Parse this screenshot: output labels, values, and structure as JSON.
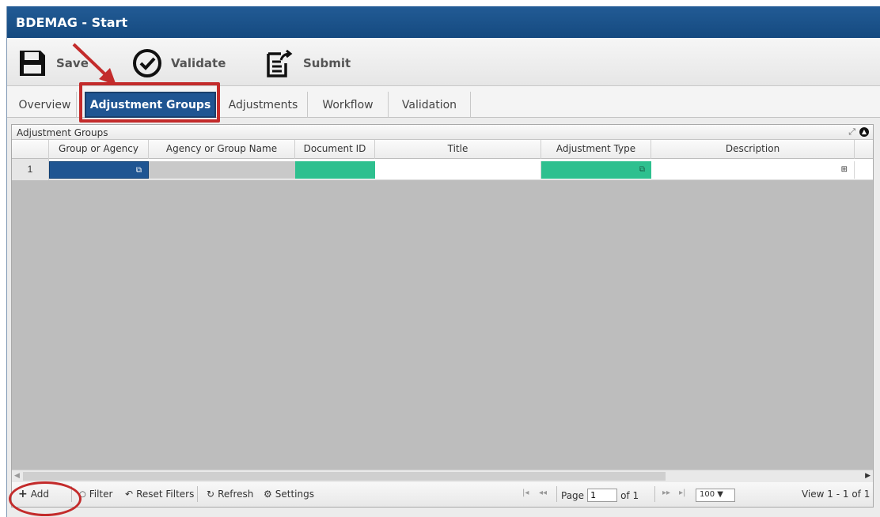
{
  "window": {
    "title": "BDEMAG - Start"
  },
  "toolbar": {
    "save_label": "Save",
    "validate_label": "Validate",
    "submit_label": "Submit"
  },
  "tabs": [
    {
      "label": "Overview",
      "active": false
    },
    {
      "label": "Adjustment Groups",
      "active": true
    },
    {
      "label": "Adjustments",
      "active": false
    },
    {
      "label": "Workflow",
      "active": false
    },
    {
      "label": "Validation",
      "active": false
    }
  ],
  "grid": {
    "caption": "Adjustment Groups",
    "columns": [
      "Group or Agency",
      "Agency or Group Name",
      "Document ID",
      "Title",
      "Adjustment Type",
      "Description"
    ],
    "rows": [
      {
        "number": "1",
        "group_or_agency": "",
        "agency_or_group_name": "",
        "document_id": "",
        "title": "",
        "adjustment_type": "",
        "description": ""
      }
    ]
  },
  "pager": {
    "add_label": "Add",
    "filter_label": "Filter",
    "reset_filters_label": "Reset Filters",
    "refresh_label": "Refresh",
    "settings_label": "Settings",
    "page_label": "Page",
    "page_value": "1",
    "of_label": "of 1",
    "rows_per_page": "100 ▼",
    "view_text": "View 1 - 1 of 1"
  },
  "colors": {
    "accent_blue": "#1f5592",
    "teal_cell": "#2ec08f",
    "annotation_red": "#c32b2b"
  }
}
